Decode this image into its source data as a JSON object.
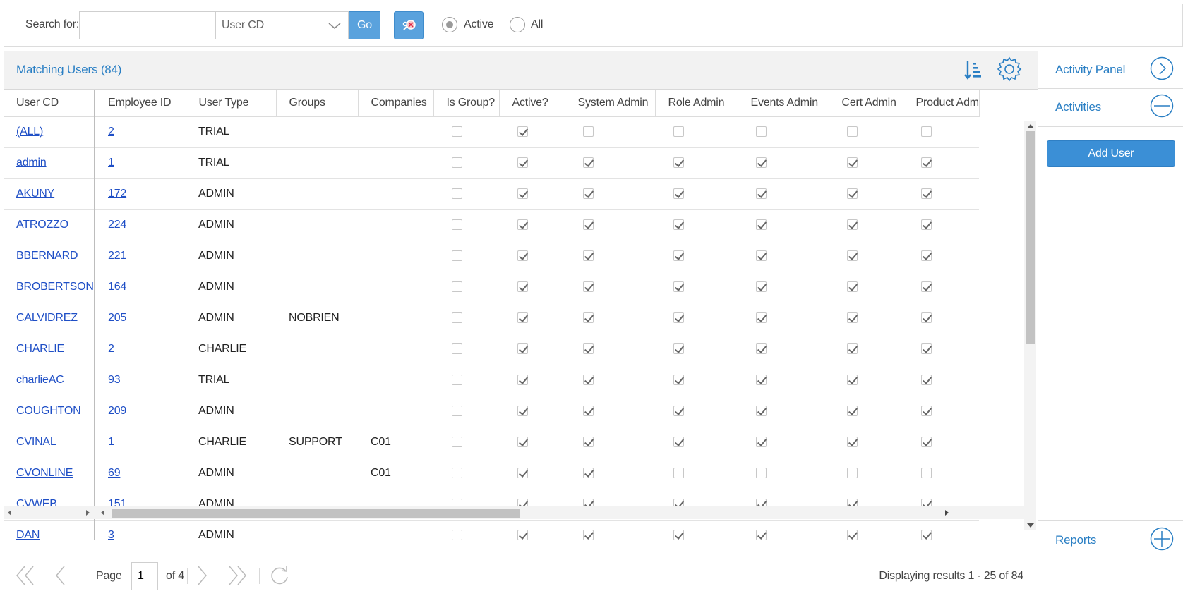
{
  "toolbar": {
    "search_label": "Search for:",
    "search_value": "",
    "field_select_value": "User CD",
    "go_label": "Go",
    "radio_active_label": "Active",
    "radio_all_label": "All",
    "selected_radio": "Active"
  },
  "grid": {
    "title": "Matching Users (84)",
    "columns": [
      "User CD",
      "Employee ID",
      "User Type",
      "Groups",
      "Companies",
      "Is Group?",
      "Active?",
      "System Admin",
      "Role Admin",
      "Events Admin",
      "Cert Admin",
      "Product Adm"
    ],
    "rows": [
      {
        "user_cd": "(ALL)",
        "employee_id": "2",
        "user_type": "TRIAL",
        "groups": "",
        "companies": "",
        "flags": [
          0,
          1,
          0,
          0,
          0,
          0,
          0
        ]
      },
      {
        "user_cd": "admin",
        "employee_id": "1",
        "user_type": "TRIAL",
        "groups": "",
        "companies": "",
        "flags": [
          0,
          1,
          1,
          1,
          1,
          1,
          1
        ]
      },
      {
        "user_cd": "AKUNY",
        "employee_id": "172",
        "user_type": "ADMIN",
        "groups": "",
        "companies": "",
        "flags": [
          0,
          1,
          1,
          1,
          1,
          1,
          1
        ]
      },
      {
        "user_cd": "ATROZZO",
        "employee_id": "224",
        "user_type": "ADMIN",
        "groups": "",
        "companies": "",
        "flags": [
          0,
          1,
          1,
          1,
          1,
          1,
          1
        ]
      },
      {
        "user_cd": "BBERNARD",
        "employee_id": "221",
        "user_type": "ADMIN",
        "groups": "",
        "companies": "",
        "flags": [
          0,
          1,
          1,
          1,
          1,
          1,
          1
        ]
      },
      {
        "user_cd": "BROBERTSON",
        "employee_id": "164",
        "user_type": "ADMIN",
        "groups": "",
        "companies": "",
        "flags": [
          0,
          1,
          1,
          1,
          1,
          1,
          1
        ]
      },
      {
        "user_cd": "CALVIDREZ",
        "employee_id": "205",
        "user_type": "ADMIN",
        "groups": "NOBRIEN",
        "companies": "",
        "flags": [
          0,
          1,
          1,
          1,
          1,
          1,
          1
        ]
      },
      {
        "user_cd": "CHARLIE",
        "employee_id": "2",
        "user_type": "CHARLIE",
        "groups": "",
        "companies": "",
        "flags": [
          0,
          1,
          1,
          1,
          1,
          1,
          1
        ]
      },
      {
        "user_cd": "charlieAC",
        "employee_id": "93",
        "user_type": "TRIAL",
        "groups": "",
        "companies": "",
        "flags": [
          0,
          1,
          1,
          1,
          1,
          1,
          1
        ]
      },
      {
        "user_cd": "COUGHTON",
        "employee_id": "209",
        "user_type": "ADMIN",
        "groups": "",
        "companies": "",
        "flags": [
          0,
          1,
          1,
          1,
          1,
          1,
          1
        ]
      },
      {
        "user_cd": "CVINAL",
        "employee_id": "1",
        "user_type": "CHARLIE",
        "groups": "SUPPORT",
        "companies": "C01",
        "flags": [
          0,
          1,
          1,
          1,
          1,
          1,
          1
        ]
      },
      {
        "user_cd": "CVONLINE",
        "employee_id": "69",
        "user_type": "ADMIN",
        "groups": "",
        "companies": "C01",
        "flags": [
          0,
          1,
          1,
          0,
          0,
          0,
          0
        ]
      },
      {
        "user_cd": "CVWEB",
        "employee_id": "151",
        "user_type": "ADMIN",
        "groups": "",
        "companies": "",
        "flags": [
          0,
          1,
          1,
          1,
          1,
          1,
          1
        ]
      },
      {
        "user_cd": "DAN",
        "employee_id": "3",
        "user_type": "ADMIN",
        "groups": "",
        "companies": "",
        "flags": [
          0,
          1,
          1,
          1,
          1,
          1,
          1
        ]
      }
    ]
  },
  "pager": {
    "page_label": "Page",
    "current_page": "1",
    "of_label": "of 4",
    "results_text": "Displaying results 1 - 25 of 84"
  },
  "activity_panel": {
    "title": "Activity Panel",
    "activities_label": "Activities",
    "add_user_label": "Add User",
    "reports_label": "Reports"
  },
  "colors": {
    "accent": "#2a7fc4",
    "button": "#5aa2dd",
    "link": "#1f4fc6"
  }
}
